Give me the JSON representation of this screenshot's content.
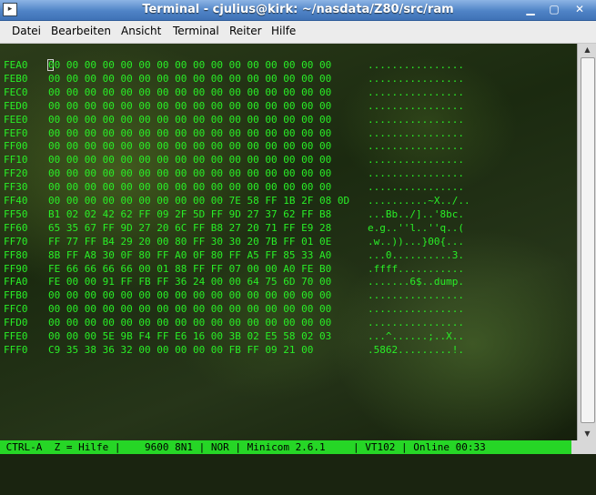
{
  "window": {
    "title": "Terminal - cjulius@kirk: ~/nasdata/Z80/src/ram"
  },
  "menu": [
    "Datei",
    "Bearbeiten",
    "Ansicht",
    "Terminal",
    "Reiter",
    "Hilfe"
  ],
  "dump": [
    {
      "addr": "FEA0",
      "bytes": "00 00 00 00 00 00 00 00 00 00 00 00 00 00 00 00",
      "ascii": "................"
    },
    {
      "addr": "FEB0",
      "bytes": "00 00 00 00 00 00 00 00 00 00 00 00 00 00 00 00",
      "ascii": "................"
    },
    {
      "addr": "FEC0",
      "bytes": "00 00 00 00 00 00 00 00 00 00 00 00 00 00 00 00",
      "ascii": "................"
    },
    {
      "addr": "FED0",
      "bytes": "00 00 00 00 00 00 00 00 00 00 00 00 00 00 00 00",
      "ascii": "................"
    },
    {
      "addr": "FEE0",
      "bytes": "00 00 00 00 00 00 00 00 00 00 00 00 00 00 00 00",
      "ascii": "................"
    },
    {
      "addr": "FEF0",
      "bytes": "00 00 00 00 00 00 00 00 00 00 00 00 00 00 00 00",
      "ascii": "................"
    },
    {
      "addr": "FF00",
      "bytes": "00 00 00 00 00 00 00 00 00 00 00 00 00 00 00 00",
      "ascii": "................"
    },
    {
      "addr": "FF10",
      "bytes": "00 00 00 00 00 00 00 00 00 00 00 00 00 00 00 00",
      "ascii": "................"
    },
    {
      "addr": "FF20",
      "bytes": "00 00 00 00 00 00 00 00 00 00 00 00 00 00 00 00",
      "ascii": "................"
    },
    {
      "addr": "FF30",
      "bytes": "00 00 00 00 00 00 00 00 00 00 00 00 00 00 00 00",
      "ascii": "................"
    },
    {
      "addr": "FF40",
      "bytes": "00 00 00 00 00 00 00 00 00 00 7E 58 FF 1B 2F 08 0D",
      "ascii": "..........~X../.."
    },
    {
      "addr": "FF50",
      "bytes": "B1 02 02 42 62 FF 09 2F 5D FF 9D 27 37 62 FF B8",
      "ascii": "...Bb../]..'8bc."
    },
    {
      "addr": "FF60",
      "bytes": "65 35 67 FF 9D 27 20 6C FF B8 27 20 71 FF E9 28",
      "ascii": "e.g..''l..''q..("
    },
    {
      "addr": "FF70",
      "bytes": "FF 77 FF B4 29 20 00 80 FF 30 30 20 7B FF 01 0E",
      "ascii": ".w..))...}00{..."
    },
    {
      "addr": "FF80",
      "bytes": "8B FF A8 30 0F 80 FF A0 0F 80 FF A5 FF 85 33 A0",
      "ascii": "...0..........3."
    },
    {
      "addr": "FF90",
      "bytes": "FE 66 66 66 66 00 01 88 FF FF 07 00 00 A0 FE B0",
      "ascii": ".ffff..........."
    },
    {
      "addr": "FFA0",
      "bytes": "FE 00 00 91 FF FB FF 36 24 00 00 64 75 6D 70 00",
      "ascii": ".......6$..dump."
    },
    {
      "addr": "FFB0",
      "bytes": "00 00 00 00 00 00 00 00 00 00 00 00 00 00 00 00",
      "ascii": "................"
    },
    {
      "addr": "FFC0",
      "bytes": "00 00 00 00 00 00 00 00 00 00 00 00 00 00 00 00",
      "ascii": "................"
    },
    {
      "addr": "FFD0",
      "bytes": "00 00 00 00 00 00 00 00 00 00 00 00 00 00 00 00",
      "ascii": "................"
    },
    {
      "addr": "FFE0",
      "bytes": "00 00 00 5E 9B F4 FF E6 16 00 3B 02 E5 58 02 03",
      "ascii": "...^......;..X.."
    },
    {
      "addr": "FFF0",
      "bytes": "C9 35 38 36 32 00 00 00 00 00 FB FF 09 21 00",
      "ascii": ".5862.........!."
    }
  ],
  "status": {
    "ctrl": " CTRL-A  Z = Hilfe |",
    "baud": "9600 8N1 | NOR | Minicom 2.6.1",
    "term": "| VT102 | Online 00:33"
  }
}
